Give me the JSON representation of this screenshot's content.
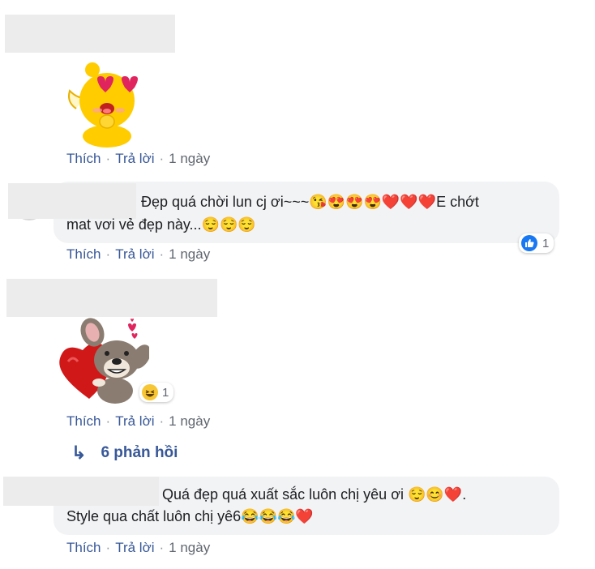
{
  "comments": [
    {
      "type": "sticker",
      "sticker_icon": "chick-heart-eyes-sticker",
      "actions": {
        "like": "Thích",
        "reply": "Trả lời",
        "time": "1 ngày"
      }
    },
    {
      "type": "text",
      "line1": "Đẹp quá chời lun cj ơi~~~😘😍😍😍❤️❤️❤️E chớt",
      "line2": "mat vơi vẻ đẹp này...😌😌😌",
      "reaction_count": "1",
      "reaction_icon": "like-icon",
      "actions": {
        "like": "Thích",
        "reply": "Trả lời",
        "time": "1 ngày"
      }
    },
    {
      "type": "sticker",
      "sticker_icon": "mouse-heart-sticker",
      "reaction_count": "1",
      "reaction_icon": "haha-icon",
      "actions": {
        "like": "Thích",
        "reply": "Trả lời",
        "time": "1 ngày"
      }
    },
    {
      "type": "text",
      "line1": "Quá đẹp quá xuất sắc luôn chị yêu ơi 😌😊❤️.",
      "line2": "Style qua chất luôn chị yê6😂😂😂❤️",
      "actions": {
        "like": "Thích",
        "reply": "Trả lời",
        "time": "1 ngày"
      }
    }
  ],
  "replies_link": "6 phản hồi",
  "colors": {
    "link": "#385898",
    "bubble": "#f2f3f5",
    "like_blue": "#1877f2",
    "heart_red": "#e0245e"
  }
}
